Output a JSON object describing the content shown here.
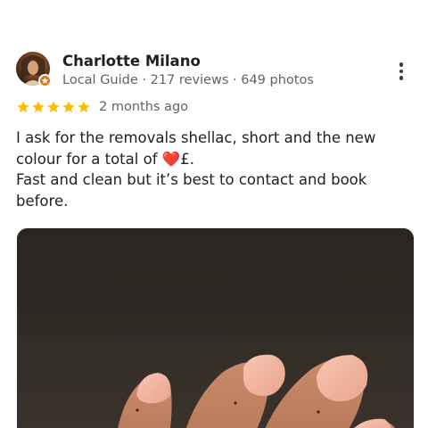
{
  "review": {
    "author": {
      "name": "Charlotte Milano",
      "meta": "Local Guide · 217 reviews · 649 photos",
      "avatar_icon": "user-avatar",
      "badge_icon": "local-guide-badge-icon",
      "badge_color": "#e8710a"
    },
    "more_icon": "more-vertical-icon",
    "rating": {
      "stars": 5,
      "max": 5,
      "star_color": "#fbbc04",
      "time_ago": "2 months ago"
    },
    "text_before_emoji": "I ask for the removals shellac, short and the new colour for a total of ",
    "emoji": "❤️",
    "text_after_emoji": "£.\nFast and clean but it’s best to contact and book before.",
    "photo": {
      "description_icon": "review-photo",
      "nail_color": "#f0b49f"
    }
  }
}
